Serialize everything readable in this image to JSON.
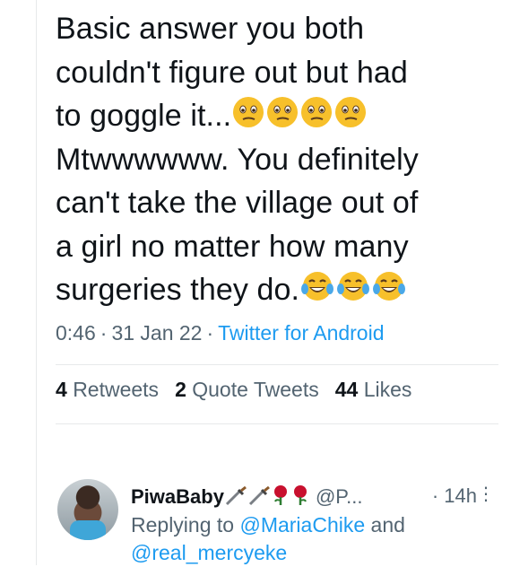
{
  "tweet": {
    "line1": "Basic answer you both",
    "line2": "couldn't figure out but had",
    "line3": "to goggle it...",
    "line4": "Mtwwwwww. You definitely",
    "line5": "can't take the village out of",
    "line6": "a girl no matter how many",
    "line7": "surgeries they do.",
    "emoji_confused": "confused-face",
    "emoji_laugh": "face-with-tears-of-joy"
  },
  "meta": {
    "time": "0:46",
    "date": "31 Jan 22",
    "source": "Twitter for Android",
    "sep": "·"
  },
  "stats": {
    "retweets_count": "4",
    "retweets_label": "Retweets",
    "quotes_count": "2",
    "quotes_label": "Quote Tweets",
    "likes_count": "44",
    "likes_label": "Likes"
  },
  "reply": {
    "name": "PiwaBaby",
    "handle": "@P...",
    "time": "· 14h",
    "replying_prefix": "Replying to",
    "mention1": "@MariaChike",
    "and": "and",
    "mention2": "@real_mercyeke",
    "more_icon": "⋮"
  },
  "colors": {
    "link": "#1d9bf0",
    "muted": "#536471",
    "text": "#0f1419"
  }
}
